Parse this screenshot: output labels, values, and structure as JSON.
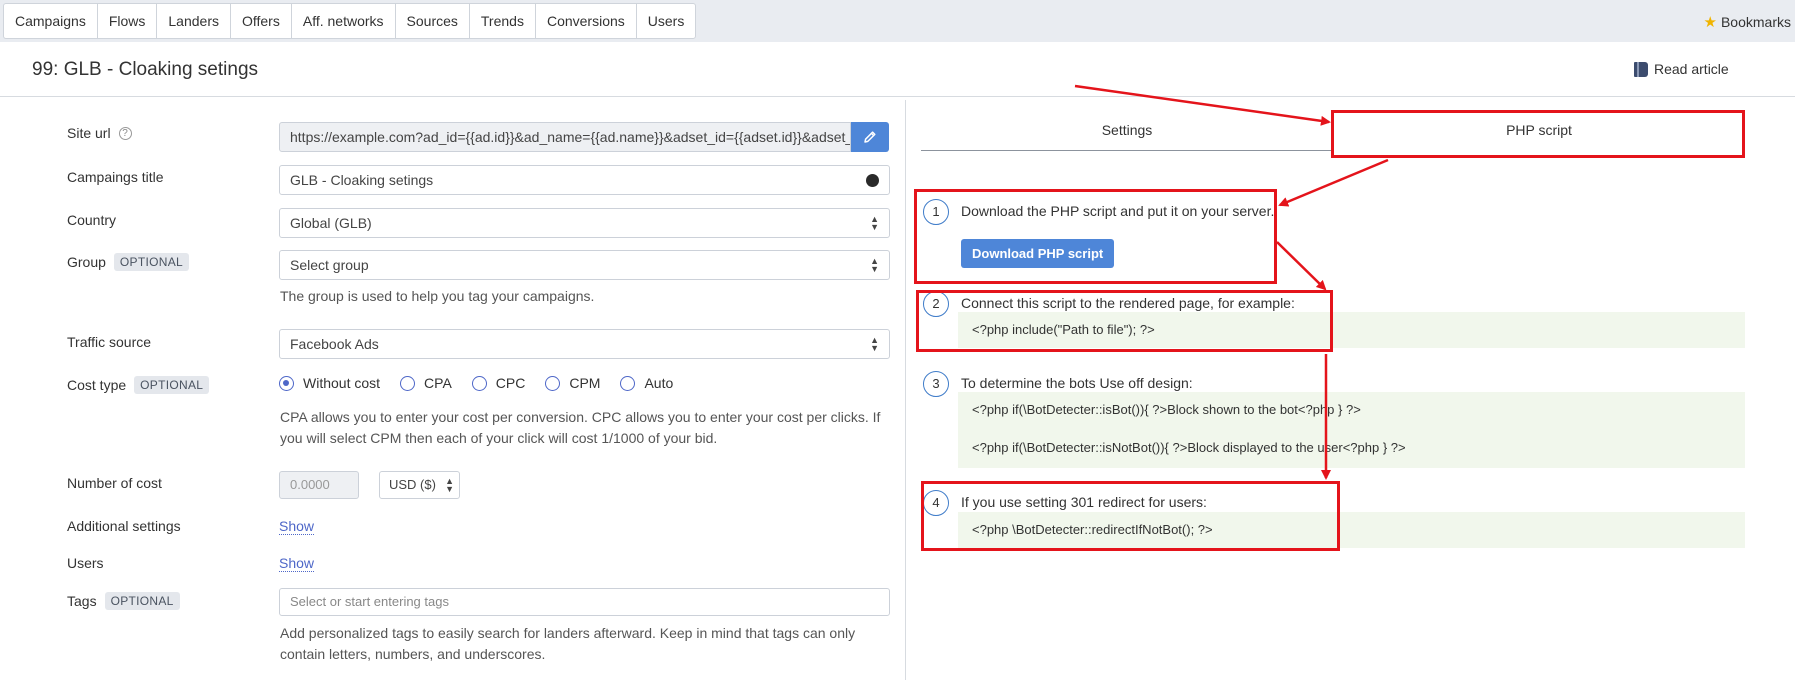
{
  "nav": {
    "tabs": [
      "Campaigns",
      "Flows",
      "Landers",
      "Offers",
      "Aff. networks",
      "Sources",
      "Trends",
      "Conversions",
      "Users"
    ],
    "bookmarks": "Bookmarks"
  },
  "header": {
    "title": "99: GLB - Cloaking setings",
    "read_article": "Read article"
  },
  "form": {
    "site_url": {
      "label": "Site url",
      "value": "https://example.com?ad_id={{ad.id}}&ad_name={{ad.name}}&adset_id={{adset.id}}&adset_name"
    },
    "campaign_title": {
      "label": "Campaings title",
      "value": "GLB - Cloaking setings",
      "color": "#2a2a2a"
    },
    "country": {
      "label": "Country",
      "value": "Global (GLB)"
    },
    "group": {
      "label": "Group",
      "badge": "OPTIONAL",
      "placeholder": "Select group",
      "hint": "The group is used to help you tag your campaigns."
    },
    "traffic_source": {
      "label": "Traffic source",
      "value": "Facebook Ads"
    },
    "cost_type": {
      "label": "Cost type",
      "badge": "OPTIONAL",
      "options": [
        "Without cost",
        "CPA",
        "CPC",
        "CPM",
        "Auto"
      ],
      "selected": "Without cost",
      "hint_line1": "CPA allows you to enter your cost per conversion. CPC allows you to enter your cost per clicks. If",
      "hint_line2": "you will select CPM then each of your click will cost 1/1000 of your bid."
    },
    "number_of_cost": {
      "label": "Number of cost",
      "value": "0.0000",
      "currency": "USD ($)"
    },
    "additional_settings": {
      "label": "Additional settings",
      "link": "Show"
    },
    "users": {
      "label": "Users",
      "link": "Show"
    },
    "tags": {
      "label": "Tags",
      "badge": "OPTIONAL",
      "placeholder": "Select or start entering tags",
      "hint_line1": "Add personalized tags to easily search for landers afterward. Keep in mind that tags can only",
      "hint_line2": "contain letters, numbers, and underscores."
    }
  },
  "panel": {
    "tabs": [
      "Settings",
      "PHP script"
    ],
    "active_tab": "PHP script",
    "steps": [
      {
        "num": "1",
        "text": "Download the PHP script and put it on your server.",
        "button": "Download PHP script"
      },
      {
        "num": "2",
        "text": "Connect this script to the rendered page, for example:",
        "code": [
          "<?php include(\"Path to file\"); ?>"
        ]
      },
      {
        "num": "3",
        "text": "To determine the bots Use off design:",
        "code": [
          "<?php if(\\BotDetecter::isBot()){ ?>Block shown to the bot<?php } ?>",
          "<?php if(\\BotDetecter::isNotBot()){ ?>Block displayed to the user<?php } ?>"
        ]
      },
      {
        "num": "4",
        "text": "If you use setting 301 redirect for users:",
        "code": [
          "<?php \\BotDetecter::redirectIfNotBot(); ?>"
        ]
      }
    ]
  },
  "colors": {
    "accent": "#4e86d8",
    "annotation": "#e4141b",
    "code_bg": "#f1f7ec"
  }
}
